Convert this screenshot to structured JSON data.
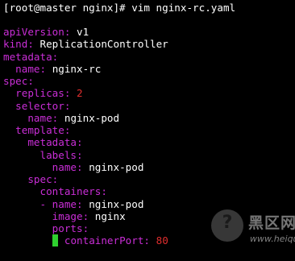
{
  "terminal": {
    "prompt": "[root@master nginx]# vim nginx-rc.yaml",
    "lines": [
      {
        "indent": "",
        "key": "apiVersion",
        "value": "v1"
      },
      {
        "indent": "",
        "key": "kind",
        "value": "ReplicationController"
      },
      {
        "indent": "",
        "key": "metadata",
        "value": ""
      },
      {
        "indent": "  ",
        "key": "name",
        "value": "nginx-rc"
      },
      {
        "indent": "",
        "key": "spec",
        "value": ""
      },
      {
        "indent": "  ",
        "key": "replicas",
        "value": "2"
      },
      {
        "indent": "  ",
        "key": "selector",
        "value": ""
      },
      {
        "indent": "    ",
        "key": "name",
        "value": "nginx-pod"
      },
      {
        "indent": "  ",
        "key": "template",
        "value": ""
      },
      {
        "indent": "    ",
        "key": "metadata",
        "value": ""
      },
      {
        "indent": "      ",
        "key": "labels",
        "value": ""
      },
      {
        "indent": "        ",
        "key": "name",
        "value": "nginx-pod"
      },
      {
        "indent": "    ",
        "key": "spec",
        "value": ""
      },
      {
        "indent": "      ",
        "key": "containers",
        "value": ""
      },
      {
        "indent": "      ",
        "dash": "- ",
        "key": "name",
        "value": "nginx-pod"
      },
      {
        "indent": "        ",
        "key": "image",
        "value": "nginx"
      },
      {
        "indent": "        ",
        "key": "ports",
        "value": ""
      },
      {
        "indent": "        ",
        "dash": "- ",
        "key": "containerPort",
        "value": "80"
      }
    ],
    "colors": {
      "background": "#000000",
      "text": "#ffffff",
      "key": "#ca2ed7",
      "number": "#e02d2d",
      "cursor": "#2fd12f"
    }
  },
  "watermark": {
    "logo_glyph": "?",
    "title": "黑区网络",
    "url": "www.heiqu.com"
  }
}
